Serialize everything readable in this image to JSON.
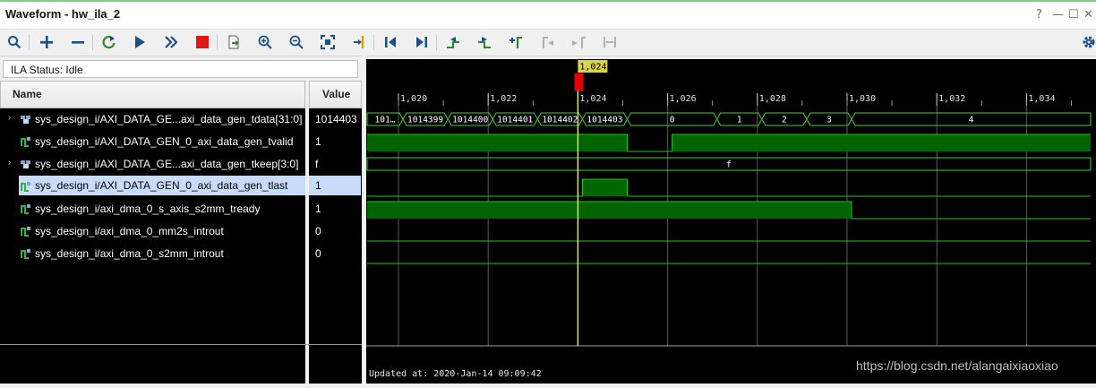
{
  "window": {
    "title": "Waveform - hw_ila_2",
    "controls": [
      "?",
      "—",
      "☐",
      "✕"
    ]
  },
  "toolbar": {
    "icons": [
      "search-icon",
      "add-icon",
      "remove-icon",
      "refresh-icon",
      "run-trigger-icon",
      "run-immediate-icon",
      "stop-icon",
      "export-icon",
      "zoom-in-icon",
      "zoom-out-icon",
      "zoom-fit-icon",
      "go-to-cursor-icon",
      "go-to-start-icon",
      "go-to-end-icon",
      "previous-transition-icon",
      "next-transition-icon",
      "add-marker-icon",
      "previous-marker-icon",
      "next-marker-icon",
      "swap-cursor-icon",
      "settings-icon"
    ]
  },
  "ila_status": "ILA Status: Idle",
  "columns": {
    "name": "Name",
    "value": "Value"
  },
  "signals": [
    {
      "name": "sys_design_i/AXI_DATA_GE...axi_data_gen_tdata[31:0]",
      "value": "1014403",
      "type": "bus",
      "expandable": true
    },
    {
      "name": "sys_design_i/AXI_DATA_GEN_0_axi_data_gen_tvalid",
      "value": "1",
      "type": "bit",
      "expandable": false
    },
    {
      "name": "sys_design_i/AXI_DATA_GE...axi_data_gen_tkeep[3:0]",
      "value": "f",
      "type": "bus",
      "expandable": true
    },
    {
      "name": "sys_design_i/AXI_DATA_GEN_0_axi_data_gen_tlast",
      "value": "1",
      "type": "bit",
      "expandable": false,
      "selected": true
    },
    {
      "name": "sys_design_i/axi_dma_0_s_axis_s2mm_tready",
      "value": "1",
      "type": "bit",
      "expandable": false
    },
    {
      "name": "sys_design_i/axi_dma_0_mm2s_introut",
      "value": "0",
      "type": "bit",
      "expandable": false
    },
    {
      "name": "sys_design_i/axi_dma_0_s2mm_introut",
      "value": "0",
      "type": "bit",
      "expandable": false
    }
  ],
  "timeline": {
    "ticks": [
      {
        "t": 1020,
        "label": "1,020"
      },
      {
        "t": 1022,
        "label": "1,022"
      },
      {
        "t": 1024,
        "label": "1,024"
      },
      {
        "t": 1026,
        "label": "1,026"
      },
      {
        "t": 1028,
        "label": "1,028"
      },
      {
        "t": 1030,
        "label": "1,030"
      },
      {
        "t": 1032,
        "label": "1,032"
      },
      {
        "t": 1034,
        "label": "1,034"
      }
    ],
    "cursor": {
      "t": 1024,
      "label": "1,024"
    },
    "start": 1019.3,
    "end": 1035.5,
    "updated": "Updated at: 2020-Jan-14 09:09:42"
  },
  "waves": {
    "tdata": [
      {
        "from": 1019.3,
        "to": 1020.1,
        "label": "101…"
      },
      {
        "from": 1020.1,
        "to": 1021.1,
        "label": "1014399"
      },
      {
        "from": 1021.1,
        "to": 1022.1,
        "label": "1014400"
      },
      {
        "from": 1022.1,
        "to": 1023.1,
        "label": "1014401"
      },
      {
        "from": 1023.1,
        "to": 1024.1,
        "label": "1014402"
      },
      {
        "from": 1024.1,
        "to": 1025.1,
        "label": "1014403"
      },
      {
        "from": 1025.1,
        "to": 1027.1,
        "label": "0"
      },
      {
        "from": 1027.1,
        "to": 1028.1,
        "label": "1"
      },
      {
        "from": 1028.1,
        "to": 1029.1,
        "label": "2"
      },
      {
        "from": 1029.1,
        "to": 1030.1,
        "label": "3"
      },
      {
        "from": 1030.1,
        "to": 1035.5,
        "label": "4"
      }
    ],
    "tvalid_high": [
      [
        1019.3,
        1025.1
      ],
      [
        1026.1,
        1035.5
      ]
    ],
    "tkeep": [
      {
        "from": 1019.3,
        "to": 1035.5,
        "label": "f"
      }
    ],
    "tlast_high": [
      [
        1024.1,
        1025.1
      ]
    ],
    "tready_high": [
      [
        1019.3,
        1030.1
      ]
    ],
    "mm2s_high": [],
    "s2mm_high": []
  },
  "colors": {
    "wave_line": "#21c321",
    "wave_fill": "#006400",
    "bus_line": "#3fcf3f",
    "grid": "#5a5a5a",
    "cursor": "#e5e25a",
    "cursor_label_bg": "#d7d44a",
    "marker": "#e00000",
    "selection": "#c8dcfa"
  },
  "watermark": "https://blog.csdn.net/alangaixiaoxiao"
}
